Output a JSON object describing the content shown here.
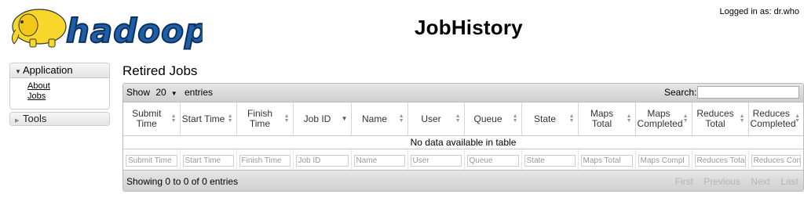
{
  "header": {
    "logo_text": "hadoop",
    "page_title": "JobHistory",
    "user_label": "Logged in as: dr.who"
  },
  "sidebar": {
    "application": {
      "label": "Application",
      "links": [
        "About",
        "Jobs"
      ]
    },
    "tools": {
      "label": "Tools"
    }
  },
  "main": {
    "section_title": "Retired Jobs",
    "table_controls": {
      "show_label": "Show",
      "entries_value": "20",
      "entries_label": "entries",
      "search_label": "Search:",
      "search_value": ""
    },
    "table": {
      "columns": [
        "Submit Time",
        "Start Time",
        "Finish Time",
        "Job ID",
        "Name",
        "User",
        "Queue",
        "State",
        "Maps Total",
        "Maps Completed",
        "Reduces Total",
        "Reduces Completed"
      ],
      "empty_message": "No data available in table",
      "filter_placeholders": [
        "Submit Time",
        "Start Time",
        "Finish Time",
        "Job ID",
        "Name",
        "User",
        "Queue",
        "State",
        "Maps Total",
        "Maps Compl",
        "Reduces Tota",
        "Reduces Con"
      ]
    },
    "footer": {
      "info": "Showing 0 to 0 of 0 entries",
      "paging": [
        "First",
        "Previous",
        "Next",
        "Last"
      ]
    }
  },
  "colors": {
    "toolbar_top": "#e6e6e6",
    "toolbar_bottom": "#cfcfcf",
    "logo_yellow": "#f7d82a",
    "logo_blue": "#1f5fa8"
  }
}
